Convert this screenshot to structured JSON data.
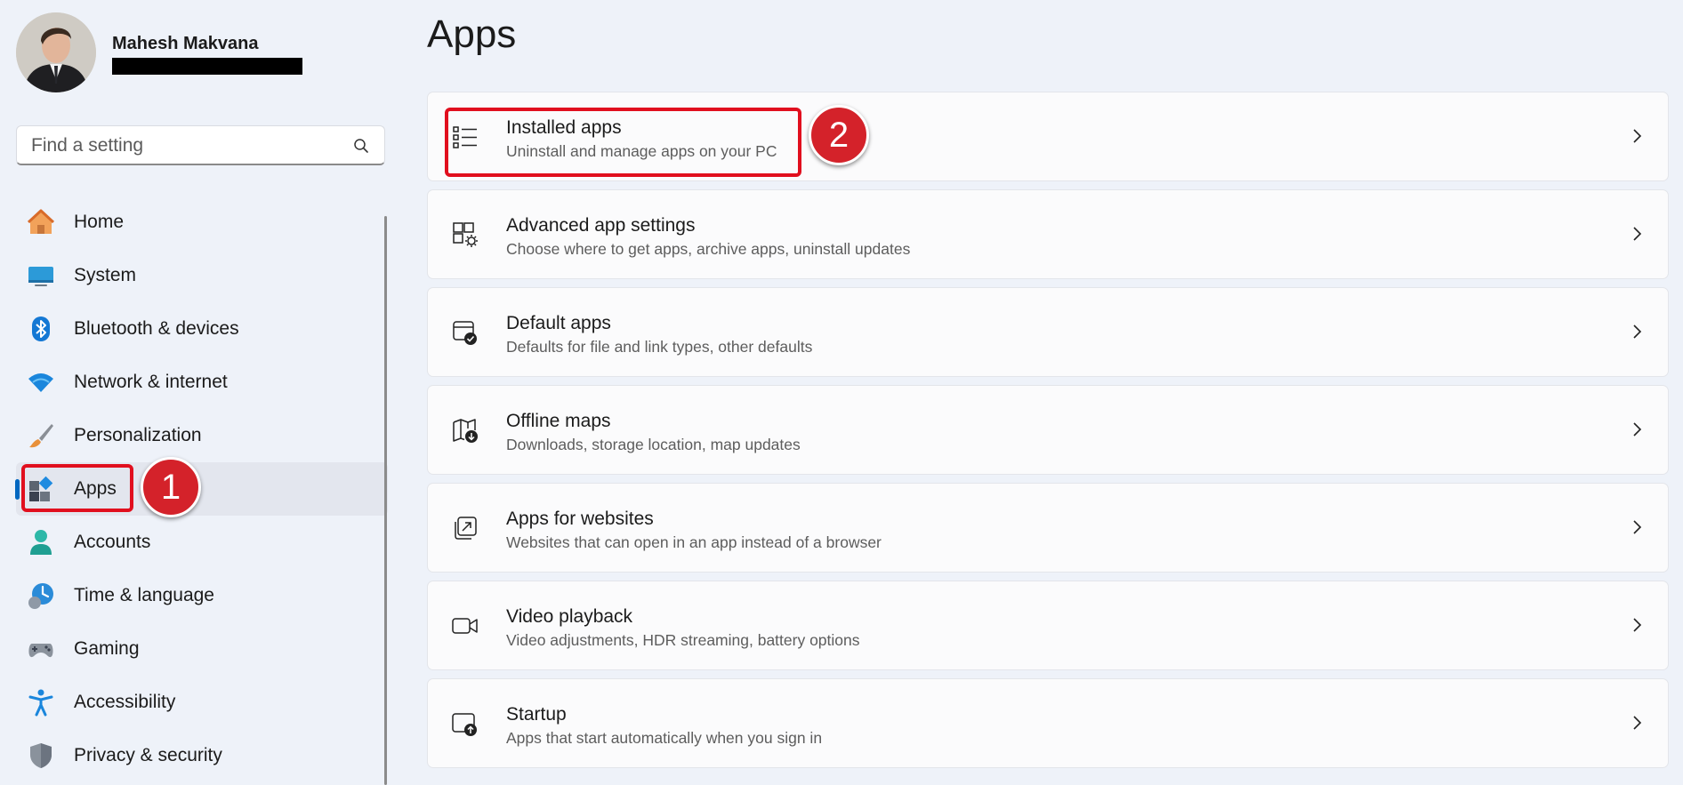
{
  "user": {
    "name": "Mahesh Makvana"
  },
  "search": {
    "placeholder": "Find a setting"
  },
  "nav": {
    "items": [
      {
        "label": "Home",
        "icon": "home-icon"
      },
      {
        "label": "System",
        "icon": "monitor-icon"
      },
      {
        "label": "Bluetooth & devices",
        "icon": "bluetooth-icon"
      },
      {
        "label": "Network & internet",
        "icon": "wifi-icon"
      },
      {
        "label": "Personalization",
        "icon": "paintbrush-icon"
      },
      {
        "label": "Apps",
        "icon": "apps-icon",
        "selected": true
      },
      {
        "label": "Accounts",
        "icon": "person-icon"
      },
      {
        "label": "Time & language",
        "icon": "clock-globe-icon"
      },
      {
        "label": "Gaming",
        "icon": "gamepad-icon"
      },
      {
        "label": "Accessibility",
        "icon": "accessibility-icon"
      },
      {
        "label": "Privacy & security",
        "icon": "shield-icon"
      }
    ]
  },
  "page": {
    "title": "Apps"
  },
  "cards": [
    {
      "title": "Installed apps",
      "description": "Uninstall and manage apps on your PC",
      "icon": "list-icon"
    },
    {
      "title": "Advanced app settings",
      "description": "Choose where to get apps, archive apps, uninstall updates",
      "icon": "app-settings-icon"
    },
    {
      "title": "Default apps",
      "description": "Defaults for file and link types, other defaults",
      "icon": "default-apps-icon"
    },
    {
      "title": "Offline maps",
      "description": "Downloads, storage location, map updates",
      "icon": "map-download-icon"
    },
    {
      "title": "Apps for websites",
      "description": "Websites that can open in an app instead of a browser",
      "icon": "open-in-app-icon"
    },
    {
      "title": "Video playback",
      "description": "Video adjustments, HDR streaming, battery options",
      "icon": "video-icon"
    },
    {
      "title": "Startup",
      "description": "Apps that start automatically when you sign in",
      "icon": "startup-icon"
    }
  ],
  "annotations": {
    "step1": "1",
    "step2": "2",
    "color": "#e10f1e"
  },
  "colors": {
    "accent": "#0067c0",
    "background": "#eef2f9",
    "card": "#fbfbfc"
  }
}
